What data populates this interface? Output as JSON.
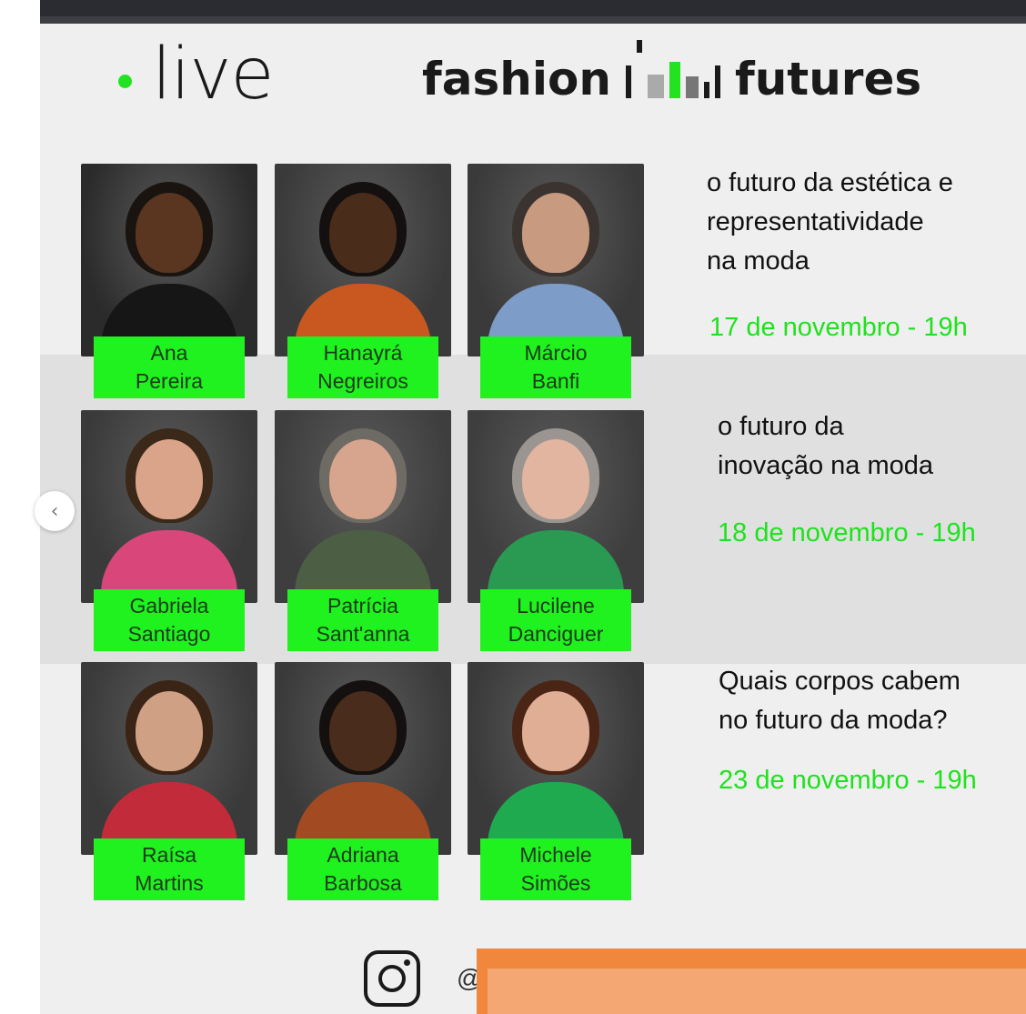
{
  "header": {
    "logo_text": "live",
    "brand_left": "fashion",
    "brand_right": "futures"
  },
  "speakers": [
    {
      "first": "Ana",
      "last": "Pereira"
    },
    {
      "first": "Hanayrá",
      "last": "Negreiros"
    },
    {
      "first": "Márcio",
      "last": "Banfi"
    },
    {
      "first": "Gabriela",
      "last": "Santiago"
    },
    {
      "first": "Patrícia",
      "last": "Sant'anna"
    },
    {
      "first": "Lucilene",
      "last": "Danciguer"
    },
    {
      "first": "Raísa",
      "last": "Martins"
    },
    {
      "first": "Adriana",
      "last": "Barbosa"
    },
    {
      "first": "Michele",
      "last": "Simões"
    }
  ],
  "events": [
    {
      "title_lines": [
        "o futuro da estética e",
        "representatividade",
        "na moda"
      ],
      "date": "17 de novembro - 19h"
    },
    {
      "title_lines": [
        "o futuro da",
        "inovação na moda"
      ],
      "date": "18 de novembro - 19h"
    },
    {
      "title_lines": [
        "Quais corpos cabem",
        "no futuro da moda?"
      ],
      "date": "23 de novembro - 19h"
    }
  ],
  "footer": {
    "handle": "@"
  },
  "colors": {
    "accent_green": "#1ff21f",
    "background": "#efefef",
    "overlay_orange": "#f0873c"
  },
  "icons": {
    "prev": "chevron-left-icon",
    "social": "instagram-icon"
  }
}
